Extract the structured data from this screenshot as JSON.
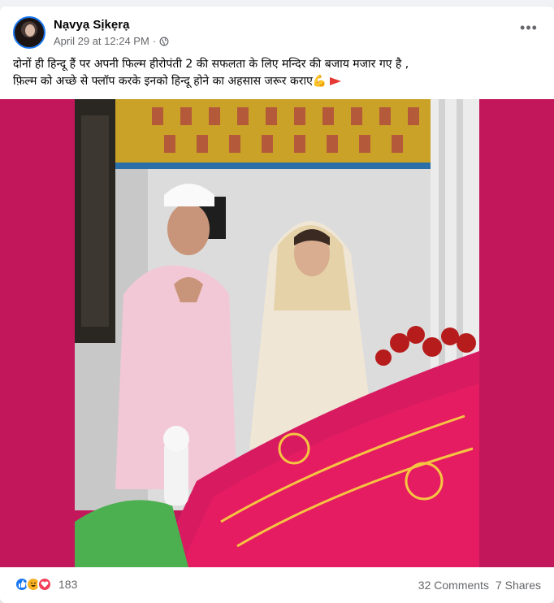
{
  "post": {
    "author": "Nạvyạ Sịkẹrạ",
    "timestamp": "April 29 at 12:24 PM",
    "separator": "·",
    "visibility_icon": "globe-icon",
    "more_icon": "more-options-icon",
    "more_label": "•••",
    "text_line1": "दोनों ही हिन्दू हैं पर अपनी फिल्म हीरोपंती 2 की सफलता के लिए मन्दिर की बजाय मजार गए है ,",
    "text_line2": "फ़िल्म को अच्छे से फ्लॉप करके इनको हिन्दू होने का अहसास जरूर कराए💪"
  },
  "reactions": {
    "icons": [
      "like-icon",
      "haha-icon",
      "love-icon"
    ],
    "count": "183"
  },
  "stats": {
    "comments": "32 Comments",
    "shares": "7 Shares"
  },
  "colors": {
    "accent": "#1877f2",
    "photo_bg": "#c2185b",
    "secondary_text": "#65676b"
  }
}
